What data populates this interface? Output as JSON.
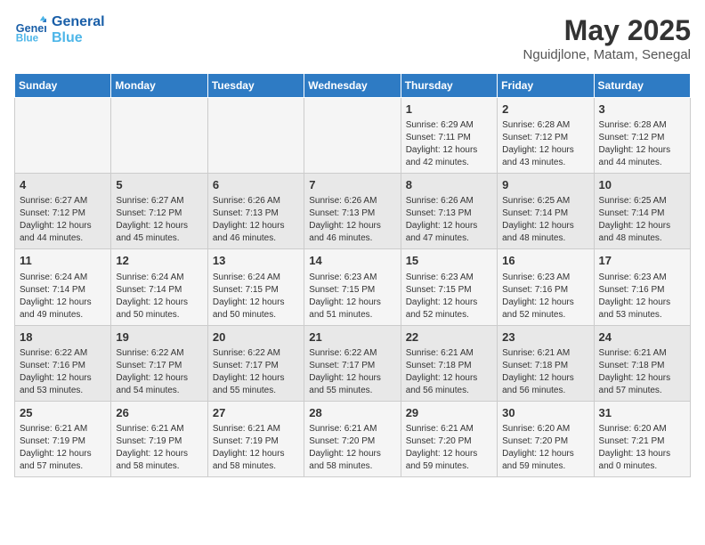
{
  "header": {
    "logo_line1": "General",
    "logo_line2": "Blue",
    "month": "May 2025",
    "location": "Nguidjlone, Matam, Senegal"
  },
  "days_of_week": [
    "Sunday",
    "Monday",
    "Tuesday",
    "Wednesday",
    "Thursday",
    "Friday",
    "Saturday"
  ],
  "weeks": [
    [
      {
        "day": "",
        "info": ""
      },
      {
        "day": "",
        "info": ""
      },
      {
        "day": "",
        "info": ""
      },
      {
        "day": "",
        "info": ""
      },
      {
        "day": "1",
        "info": "Sunrise: 6:29 AM\nSunset: 7:11 PM\nDaylight: 12 hours\nand 42 minutes."
      },
      {
        "day": "2",
        "info": "Sunrise: 6:28 AM\nSunset: 7:12 PM\nDaylight: 12 hours\nand 43 minutes."
      },
      {
        "day": "3",
        "info": "Sunrise: 6:28 AM\nSunset: 7:12 PM\nDaylight: 12 hours\nand 44 minutes."
      }
    ],
    [
      {
        "day": "4",
        "info": "Sunrise: 6:27 AM\nSunset: 7:12 PM\nDaylight: 12 hours\nand 44 minutes."
      },
      {
        "day": "5",
        "info": "Sunrise: 6:27 AM\nSunset: 7:12 PM\nDaylight: 12 hours\nand 45 minutes."
      },
      {
        "day": "6",
        "info": "Sunrise: 6:26 AM\nSunset: 7:13 PM\nDaylight: 12 hours\nand 46 minutes."
      },
      {
        "day": "7",
        "info": "Sunrise: 6:26 AM\nSunset: 7:13 PM\nDaylight: 12 hours\nand 46 minutes."
      },
      {
        "day": "8",
        "info": "Sunrise: 6:26 AM\nSunset: 7:13 PM\nDaylight: 12 hours\nand 47 minutes."
      },
      {
        "day": "9",
        "info": "Sunrise: 6:25 AM\nSunset: 7:14 PM\nDaylight: 12 hours\nand 48 minutes."
      },
      {
        "day": "10",
        "info": "Sunrise: 6:25 AM\nSunset: 7:14 PM\nDaylight: 12 hours\nand 48 minutes."
      }
    ],
    [
      {
        "day": "11",
        "info": "Sunrise: 6:24 AM\nSunset: 7:14 PM\nDaylight: 12 hours\nand 49 minutes."
      },
      {
        "day": "12",
        "info": "Sunrise: 6:24 AM\nSunset: 7:14 PM\nDaylight: 12 hours\nand 50 minutes."
      },
      {
        "day": "13",
        "info": "Sunrise: 6:24 AM\nSunset: 7:15 PM\nDaylight: 12 hours\nand 50 minutes."
      },
      {
        "day": "14",
        "info": "Sunrise: 6:23 AM\nSunset: 7:15 PM\nDaylight: 12 hours\nand 51 minutes."
      },
      {
        "day": "15",
        "info": "Sunrise: 6:23 AM\nSunset: 7:15 PM\nDaylight: 12 hours\nand 52 minutes."
      },
      {
        "day": "16",
        "info": "Sunrise: 6:23 AM\nSunset: 7:16 PM\nDaylight: 12 hours\nand 52 minutes."
      },
      {
        "day": "17",
        "info": "Sunrise: 6:23 AM\nSunset: 7:16 PM\nDaylight: 12 hours\nand 53 minutes."
      }
    ],
    [
      {
        "day": "18",
        "info": "Sunrise: 6:22 AM\nSunset: 7:16 PM\nDaylight: 12 hours\nand 53 minutes."
      },
      {
        "day": "19",
        "info": "Sunrise: 6:22 AM\nSunset: 7:17 PM\nDaylight: 12 hours\nand 54 minutes."
      },
      {
        "day": "20",
        "info": "Sunrise: 6:22 AM\nSunset: 7:17 PM\nDaylight: 12 hours\nand 55 minutes."
      },
      {
        "day": "21",
        "info": "Sunrise: 6:22 AM\nSunset: 7:17 PM\nDaylight: 12 hours\nand 55 minutes."
      },
      {
        "day": "22",
        "info": "Sunrise: 6:21 AM\nSunset: 7:18 PM\nDaylight: 12 hours\nand 56 minutes."
      },
      {
        "day": "23",
        "info": "Sunrise: 6:21 AM\nSunset: 7:18 PM\nDaylight: 12 hours\nand 56 minutes."
      },
      {
        "day": "24",
        "info": "Sunrise: 6:21 AM\nSunset: 7:18 PM\nDaylight: 12 hours\nand 57 minutes."
      }
    ],
    [
      {
        "day": "25",
        "info": "Sunrise: 6:21 AM\nSunset: 7:19 PM\nDaylight: 12 hours\nand 57 minutes."
      },
      {
        "day": "26",
        "info": "Sunrise: 6:21 AM\nSunset: 7:19 PM\nDaylight: 12 hours\nand 58 minutes."
      },
      {
        "day": "27",
        "info": "Sunrise: 6:21 AM\nSunset: 7:19 PM\nDaylight: 12 hours\nand 58 minutes."
      },
      {
        "day": "28",
        "info": "Sunrise: 6:21 AM\nSunset: 7:20 PM\nDaylight: 12 hours\nand 58 minutes."
      },
      {
        "day": "29",
        "info": "Sunrise: 6:21 AM\nSunset: 7:20 PM\nDaylight: 12 hours\nand 59 minutes."
      },
      {
        "day": "30",
        "info": "Sunrise: 6:20 AM\nSunset: 7:20 PM\nDaylight: 12 hours\nand 59 minutes."
      },
      {
        "day": "31",
        "info": "Sunrise: 6:20 AM\nSunset: 7:21 PM\nDaylight: 13 hours\nand 0 minutes."
      }
    ]
  ]
}
